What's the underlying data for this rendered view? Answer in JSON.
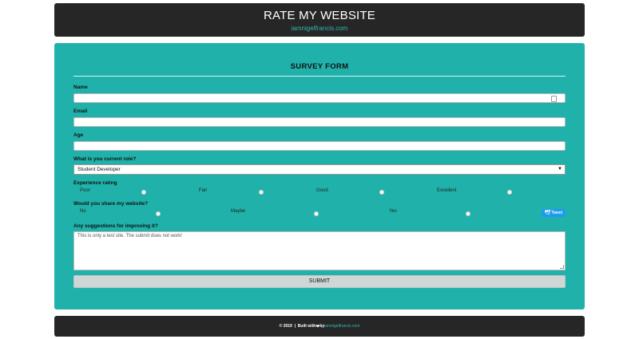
{
  "header": {
    "title": "RATE MY WEBSITE",
    "subtitle": "iamnigelfrancis.com"
  },
  "form": {
    "title": "SURVEY FORM",
    "name_label": "Name",
    "name_value": "",
    "email_label": "Email",
    "email_value": "",
    "age_label": "Age",
    "age_value": "",
    "role_label": "What is you current role?",
    "role_selected": "Student Developer",
    "experience_label": "Experience rating",
    "experience_options": [
      "Poor",
      "Fair",
      "Good",
      "Excellent"
    ],
    "share_label": "Would you share my website?",
    "share_options": [
      "No",
      "Maybe",
      "Yes"
    ],
    "tweet_label": "Tweet",
    "suggestions_label": "Any suggestions for improving it?",
    "suggestions_placeholder": "This is only a test site. The submit does not work!",
    "submit_label": "SUBMIT"
  },
  "footer": {
    "copyright": "© 2019  |  Built with",
    "by": "by",
    "link": "iamnigelfrancis.com"
  },
  "colors": {
    "header_bg": "#262626",
    "card_bg": "#20b2aa",
    "link": "#32b9b4",
    "tweet": "#1d9bf0"
  },
  "icons": [
    "heart-icon",
    "twitter-bird-icon",
    "dropdown-arrow-icon",
    "field-fill-icon"
  ]
}
